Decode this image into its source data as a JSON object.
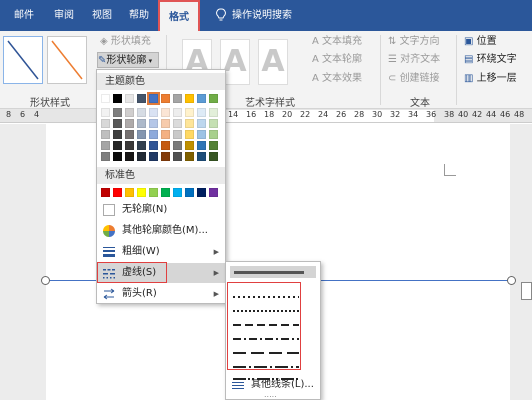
{
  "tabs": [
    {
      "label": "邮件",
      "active": false
    },
    {
      "label": "审阅",
      "active": false
    },
    {
      "label": "视图",
      "active": false
    },
    {
      "label": "帮助",
      "active": false
    },
    {
      "label": "格式",
      "active": true
    }
  ],
  "tell_me": "操作说明搜索",
  "ribbon": {
    "shape_styles_label": "形状样式",
    "shape_fill": "形状填充",
    "shape_outline": "形状轮廓",
    "art_text_label": "艺术字样式",
    "text_fill": "文本填充",
    "text_outline": "文本轮廓",
    "text_effects": "文本效果",
    "text_group_label": "文本",
    "text_direction": "文字方向",
    "align_text": "对齐文本",
    "create_link": "创建链接",
    "position": "位置",
    "wrap_text": "环绕文字",
    "bring_forward": "上移一层",
    "art_letters": [
      "A",
      "A",
      "A"
    ]
  },
  "ruler_numbers": [
    "8",
    "6",
    "4",
    "14",
    "16",
    "18",
    "20",
    "22",
    "24",
    "26",
    "28",
    "30",
    "32",
    "34",
    "36",
    "38",
    "40",
    "42",
    "44",
    "46",
    "48"
  ],
  "menu": {
    "theme_colors_label": "主题颜色",
    "standard_colors_label": "标准色",
    "no_outline": "无轮廓(N)",
    "more_colors": "其他轮廓颜色(M)...",
    "weight": "粗细(W)",
    "dashes": "虚线(S)",
    "arrows": "箭头(R)",
    "theme_top_row": [
      "#ffffff",
      "#000000",
      "#e7e6e6",
      "#44546a",
      "#4472c4",
      "#ed7d31",
      "#a5a5a5",
      "#ffc000",
      "#5b9bd5",
      "#70ad47"
    ],
    "theme_shades": [
      [
        "#f2f2f2",
        "#7f7f7f",
        "#d0cece",
        "#d6dce4",
        "#d9e2f3",
        "#fbe5d5",
        "#ededed",
        "#fff2cc",
        "#deebf6",
        "#e2efd9"
      ],
      [
        "#d8d8d8",
        "#595959",
        "#aeaaaa",
        "#adb9ca",
        "#b4c6e7",
        "#f7cbac",
        "#dbdbdb",
        "#fee599",
        "#bdd7ee",
        "#c5e0b3"
      ],
      [
        "#bfbfbf",
        "#3f3f3f",
        "#757070",
        "#8496b0",
        "#8eaadb",
        "#f4b183",
        "#c9c9c9",
        "#ffd965",
        "#9cc3e5",
        "#a8d08d"
      ],
      [
        "#a5a5a5",
        "#262626",
        "#3a3838",
        "#323f4f",
        "#2f5496",
        "#c55a11",
        "#7b7b7b",
        "#bf9000",
        "#2e75b5",
        "#538135"
      ],
      [
        "#7f7f7f",
        "#0c0c0c",
        "#171616",
        "#222a35",
        "#1f3864",
        "#833c0b",
        "#525252",
        "#7f6000",
        "#1e4e79",
        "#375623"
      ]
    ],
    "standard": [
      "#c00000",
      "#ff0000",
      "#ffc000",
      "#ffff00",
      "#92d050",
      "#00b050",
      "#00b0f0",
      "#0070c0",
      "#002060",
      "#7030a0"
    ]
  },
  "submenu": {
    "more_lines": "其他线条(L)...",
    "more_indicator": "....."
  }
}
